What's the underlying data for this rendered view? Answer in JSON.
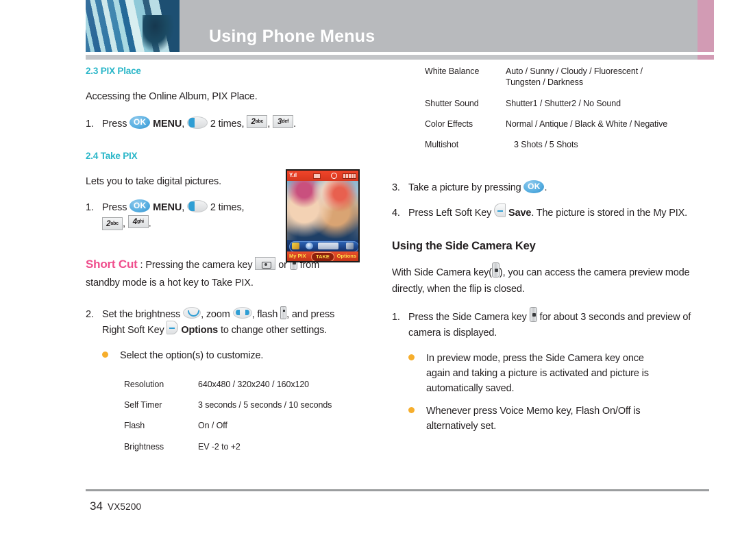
{
  "header": {
    "title": "Using Phone Menus",
    "accent_gray": "#b8babd",
    "accent_pink": "#d29bb4"
  },
  "colors": {
    "section_heading": "#29b6c8",
    "shortcut": "#ef4d8c",
    "bullet": "#f6ae2d",
    "ok_key": "#5ab0e2"
  },
  "left": {
    "pix_place": {
      "heading": "2.3 PIX Place",
      "intro": "Accessing the Online Album, PIX Place.",
      "step1": {
        "num": "1.",
        "press": "Press",
        "ok": "OK",
        "menu": "MENU",
        "comma1": ",",
        "times": "2 times,",
        "key2": "2",
        "key2_sub": "abc",
        "comma2": ",",
        "key3": "3",
        "key3_sub": "def",
        "period": "."
      }
    },
    "take_pix": {
      "heading": "2.4 Take PIX",
      "intro": "Lets you to take digital pictures.",
      "step1": {
        "num": "1.",
        "press": "Press",
        "ok": "OK",
        "menu": "MENU",
        "comma1": ",",
        "times": "2 times,",
        "key2": "2",
        "key2_sub": "abc",
        "comma2": ",",
        "key4": "4",
        "key4_sub": "ghi",
        "period": "."
      }
    },
    "shortcut": {
      "label": "Short Cut",
      "colon": ":",
      "text_a": "Pressing the camera key",
      "or": "or",
      "text_b": "from",
      "text_c": "standby mode is a hot key to Take PIX."
    },
    "step2": {
      "num": "2.",
      "t1": "Set the brightness",
      "t2": ", zoom",
      "t3": ", flash",
      "t4": ", and press",
      "t5": "Right Soft Key",
      "options": "Options",
      "t6": "to change other settings."
    },
    "bullet1": "Select the option(s) to customize.",
    "spec_table": [
      {
        "key": "Resolution",
        "value": "640x480 / 320x240 / 160x120"
      },
      {
        "key": "Self Timer",
        "value": "3 seconds / 5 seconds / 10 seconds"
      },
      {
        "key": "Flash",
        "value": "On / Off"
      },
      {
        "key": "Brightness",
        "value": "EV -2 to +2"
      }
    ]
  },
  "phone_screenshot": {
    "soft_left": "My PIX",
    "soft_center": "TAKE",
    "soft_right": "Options",
    "signal": "Y.ıl"
  },
  "right": {
    "spec_table": [
      {
        "key": "White Balance",
        "value": "Auto / Sunny / Cloudy / Fluorescent / Tungsten / Darkness"
      },
      {
        "key": "Shutter Sound",
        "value": "Shutter1 / Shutter2 / No Sound"
      },
      {
        "key": "Color Effects",
        "value": "Normal / Antique / Black & White / Negative"
      },
      {
        "key": "Multishot",
        "value": "3 Shots / 5 Shots"
      }
    ],
    "step3": {
      "num": "3.",
      "t1": "Take a picture by pressing",
      "ok": "OK",
      "period": "."
    },
    "step4": {
      "num": "4.",
      "t1": "Press Left Soft Key",
      "save": "Save",
      "t2": ". The picture is stored in the My PIX."
    },
    "side_camera": {
      "heading": "Using the Side Camera Key",
      "intro_a": "With Side Camera key(",
      "intro_b": "), you can access the camera preview mode directly, when the flip is closed.",
      "step1": {
        "num": "1.",
        "t1": "Press the Side Camera key",
        "t2": "for about 3 seconds and preview of camera is displayed."
      },
      "bullet1": "In preview mode, press the Side Camera key once again and taking a picture is activated and picture is automatically saved.",
      "bullet2": "Whenever press Voice Memo key, Flash On/Off is alternatively set."
    }
  },
  "footer": {
    "page": "34",
    "model": "VX5200"
  }
}
